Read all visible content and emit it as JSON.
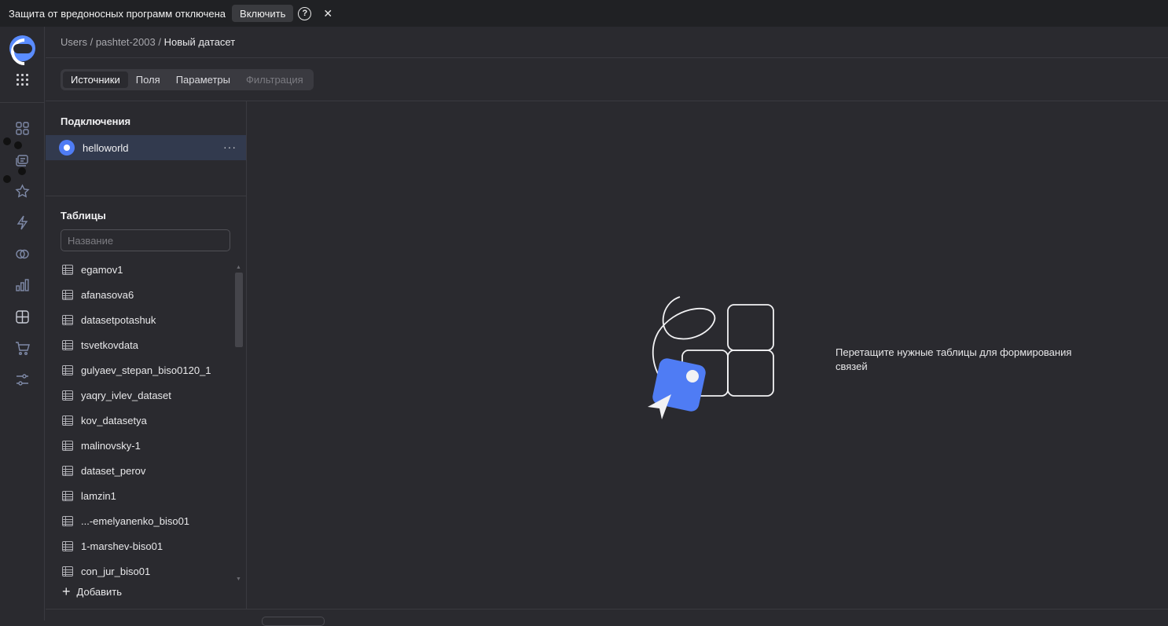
{
  "warning_bar": {
    "text": "Защита от вредоносных программ отключена",
    "enable_label": "Включить",
    "help_glyph": "?",
    "close_glyph": "✕"
  },
  "rail": {
    "icons": [
      "logo-icon",
      "apps-grid-icon",
      "collections-icon",
      "workbooks-icon",
      "favorites-icon",
      "connections-icon",
      "datasets-icon",
      "charts-icon",
      "dashboards-icon",
      "marketplace-icon",
      "settings-icon"
    ]
  },
  "breadcrumb": {
    "items": [
      "Users",
      "pashtet-2003"
    ],
    "separator": "/",
    "current": "Новый датасет"
  },
  "tabs": [
    {
      "label": "Источники",
      "active": true
    },
    {
      "label": "Поля",
      "active": false
    },
    {
      "label": "Параметры",
      "active": false
    },
    {
      "label": "Фильтрация",
      "active": false,
      "disabled": true
    }
  ],
  "connections": {
    "heading": "Подключения",
    "items": [
      {
        "label": "helloworld",
        "icon": "connection-icon",
        "more": "···"
      }
    ]
  },
  "tables": {
    "heading": "Таблицы",
    "search_placeholder": "Название",
    "items": [
      "egamov1",
      "afanasova6",
      "datasetpotashuk",
      "tsvetkovdata",
      "gulyaev_stepan_biso0120_1",
      "yaqry_ivlev_dataset",
      "kov_datasetya",
      "malinovsky-1",
      "dataset_perov",
      "lamzin1",
      "...-emelyanenko_biso01",
      "1-marshev-biso01",
      "con_jur_biso01"
    ],
    "add_label": "Добавить",
    "add_glyph": "+"
  },
  "empty_state": {
    "text": "Перетащите нужные таблицы для формирования связей",
    "accent_color": "#4f7cf4"
  },
  "colors": {
    "background": "#2a2a2f",
    "selected_row": "#323a4e",
    "brand": "#5a8cff"
  }
}
